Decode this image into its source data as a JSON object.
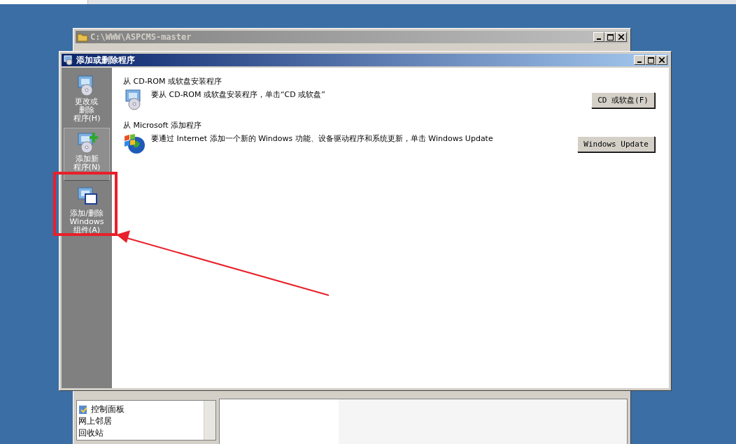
{
  "back_window": {
    "title": "C:\\WWW\\ASPCMS-master",
    "tree_items": [
      {
        "label": "控制面板",
        "kind": "icon"
      },
      {
        "label": "网上邻居",
        "kind": "plain"
      },
      {
        "label": "回收站",
        "kind": "plain"
      }
    ]
  },
  "dialog": {
    "title": "添加或删除程序",
    "sidebar": [
      {
        "lines": [
          "更改或",
          "删除",
          "程序(H)"
        ],
        "kind": "change",
        "selected": false
      },
      {
        "lines": [
          "添加新",
          "程序(N)"
        ],
        "kind": "add",
        "selected": true
      },
      {
        "lines": [
          "添加/删除",
          "Windows",
          "组件(A)"
        ],
        "kind": "components",
        "selected": false
      }
    ],
    "sections": [
      {
        "heading": "从 CD-ROM 或软盘安装程序",
        "text": "要从 CD-ROM 或软盘安装程序，单击“CD 或软盘”",
        "button": "CD 或软盘(F)",
        "kind": "cd"
      },
      {
        "heading": "从 Microsoft 添加程序",
        "text": "要通过 Internet 添加一个新的 Windows 功能、设备驱动程序和系统更新，单击 Windows Update",
        "button": "Windows Update",
        "kind": "globe"
      }
    ]
  }
}
